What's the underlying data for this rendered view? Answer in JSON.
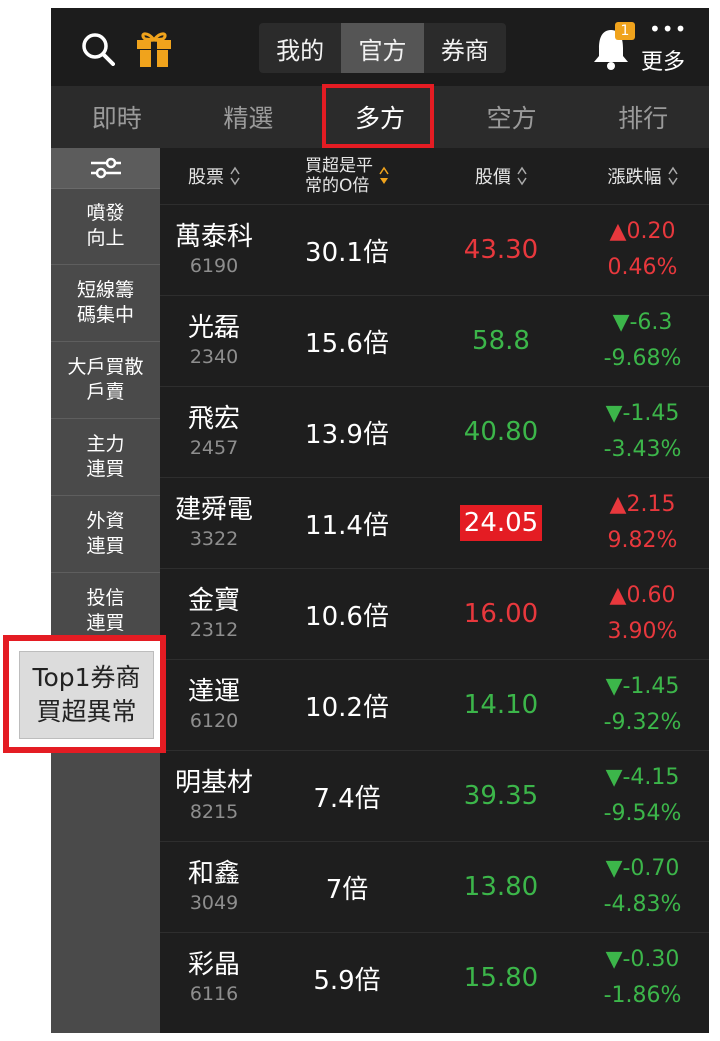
{
  "header": {
    "tabs": [
      {
        "label": "我的",
        "active": false
      },
      {
        "label": "官方",
        "active": true
      },
      {
        "label": "券商",
        "active": false
      }
    ],
    "notification_count": "1",
    "more_dots": "•••",
    "more_label": "更多"
  },
  "categories": [
    {
      "label": "即時",
      "active": false
    },
    {
      "label": "精選",
      "active": false
    },
    {
      "label": "多方",
      "active": true
    },
    {
      "label": "空方",
      "active": false
    },
    {
      "label": "排行",
      "active": false
    }
  ],
  "sidebar": {
    "items": [
      {
        "label": "噴發\n向上"
      },
      {
        "label": "短線籌\n碼集中"
      },
      {
        "label": "大戶買散\n戶賣"
      },
      {
        "label": "主力\n連買"
      },
      {
        "label": "外資\n連買"
      },
      {
        "label": "投信\n連買"
      }
    ]
  },
  "popup": {
    "label": "Top1券商\n買超異常"
  },
  "columns": {
    "stock": "股票",
    "multiple": "買超是平\n常的O倍",
    "price": "股價",
    "change": "漲跌幅"
  },
  "colors": {
    "up": "#e8383d",
    "down": "#3cb64a",
    "highlight": "#e41c23",
    "accent": "#f0a31c"
  },
  "rows": [
    {
      "name": "萬泰科",
      "code": "6190",
      "multiple": "30.1倍",
      "price": "43.30",
      "change": "▲0.20",
      "pct": "0.46%",
      "dir": "up",
      "boxed": false
    },
    {
      "name": "光磊",
      "code": "2340",
      "multiple": "15.6倍",
      "price": "58.8",
      "change": "▼-6.3",
      "pct": "-9.68%",
      "dir": "down",
      "boxed": false
    },
    {
      "name": "飛宏",
      "code": "2457",
      "multiple": "13.9倍",
      "price": "40.80",
      "change": "▼-1.45",
      "pct": "-3.43%",
      "dir": "down",
      "boxed": false
    },
    {
      "name": "建舜電",
      "code": "3322",
      "multiple": "11.4倍",
      "price": "24.05",
      "change": "▲2.15",
      "pct": "9.82%",
      "dir": "up",
      "boxed": true
    },
    {
      "name": "金寶",
      "code": "2312",
      "multiple": "10.6倍",
      "price": "16.00",
      "change": "▲0.60",
      "pct": "3.90%",
      "dir": "up",
      "boxed": false
    },
    {
      "name": "達運",
      "code": "6120",
      "multiple": "10.2倍",
      "price": "14.10",
      "change": "▼-1.45",
      "pct": "-9.32%",
      "dir": "down",
      "boxed": false
    },
    {
      "name": "明基材",
      "code": "8215",
      "multiple": "7.4倍",
      "price": "39.35",
      "change": "▼-4.15",
      "pct": "-9.54%",
      "dir": "down",
      "boxed": false
    },
    {
      "name": "和鑫",
      "code": "3049",
      "multiple": "7倍",
      "price": "13.80",
      "change": "▼-0.70",
      "pct": "-4.83%",
      "dir": "down",
      "boxed": false
    },
    {
      "name": "彩晶",
      "code": "6116",
      "multiple": "5.9倍",
      "price": "15.80",
      "change": "▼-0.30",
      "pct": "-1.86%",
      "dir": "down",
      "boxed": false
    }
  ]
}
